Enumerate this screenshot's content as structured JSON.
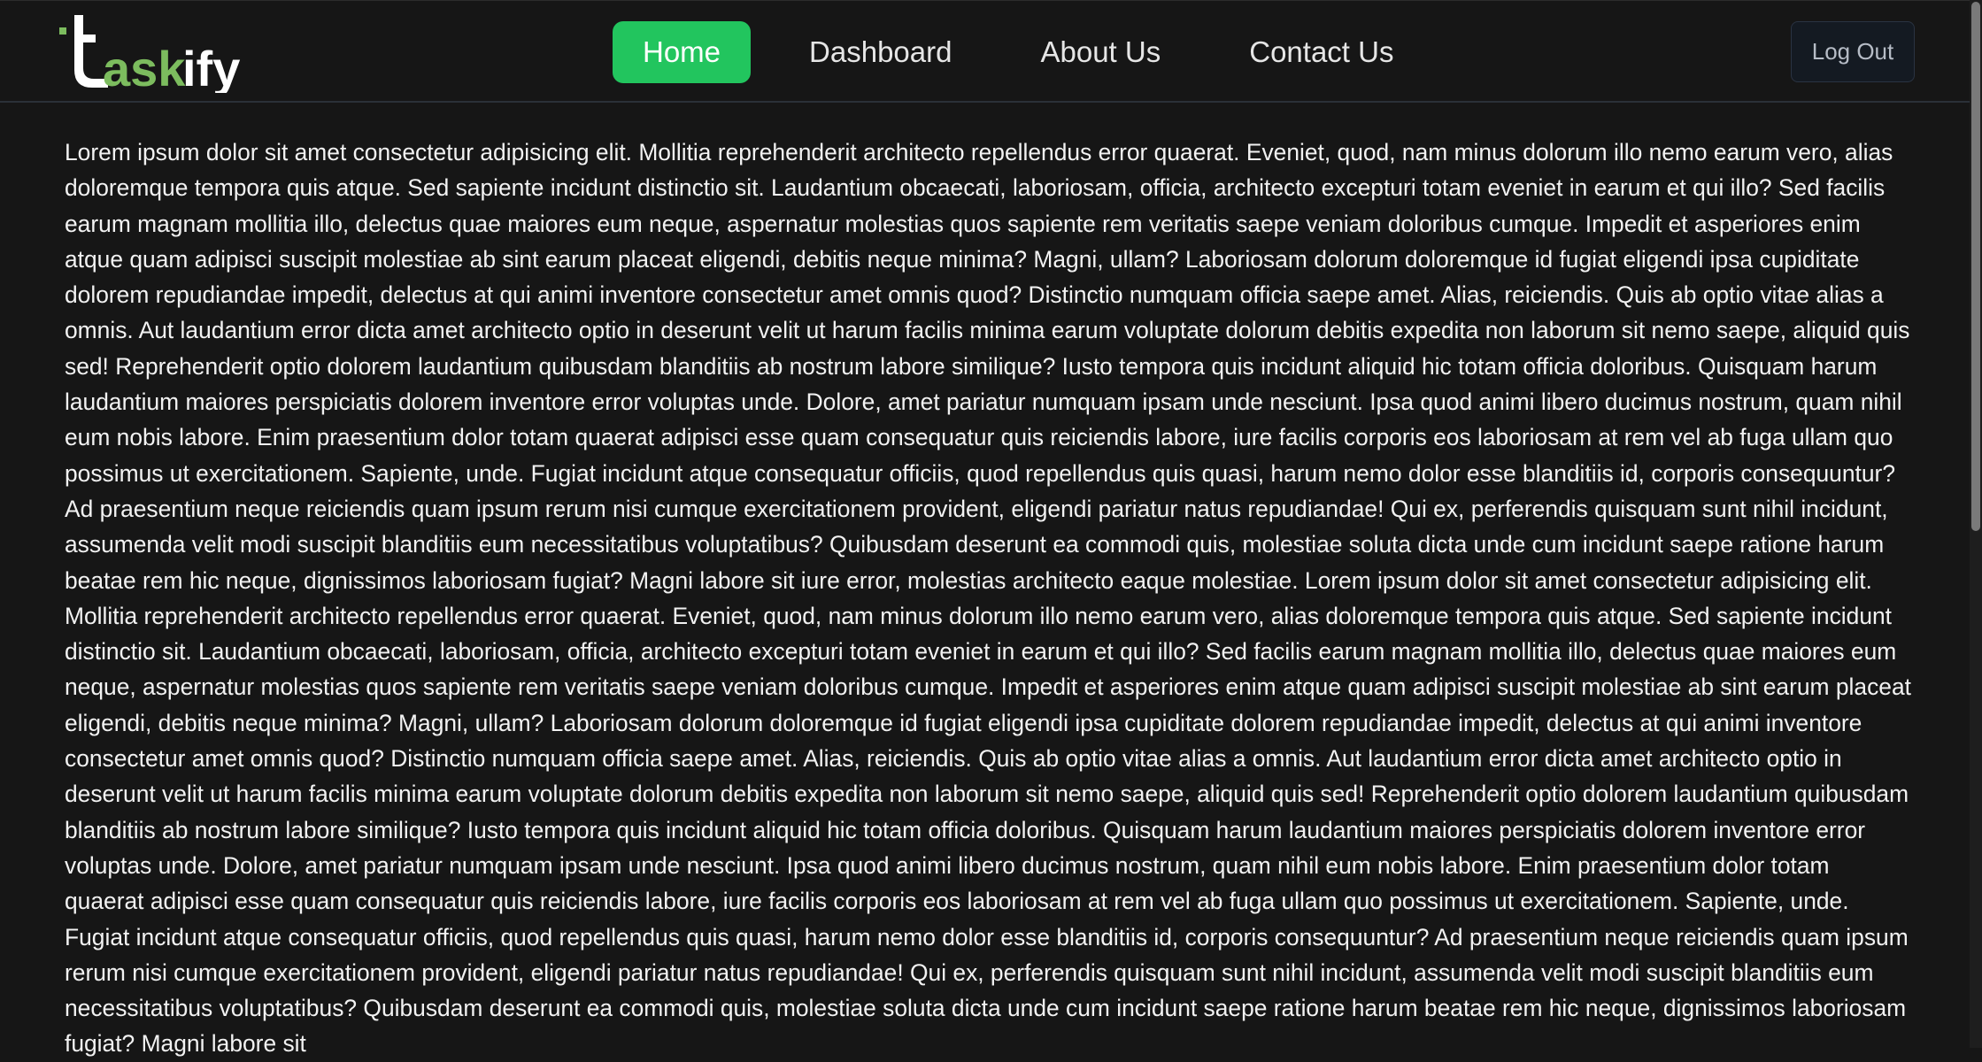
{
  "brand": {
    "name": "taskify",
    "colors": {
      "accent": "#22c55e",
      "logo_green": "#7cbc5e",
      "logo_white": "#ffffff",
      "background": "#161616"
    }
  },
  "nav": {
    "items": [
      {
        "label": "Home",
        "active": true
      },
      {
        "label": "Dashboard",
        "active": false
      },
      {
        "label": "About Us",
        "active": false
      },
      {
        "label": "Contact Us",
        "active": false
      }
    ],
    "logout_label": "Log Out"
  },
  "main": {
    "paragraph": "Lorem ipsum dolor sit amet consectetur adipisicing elit. Mollitia reprehenderit architecto repellendus error quaerat. Eveniet, quod, nam minus dolorum illo nemo earum vero, alias doloremque tempora quis atque. Sed sapiente incidunt distinctio sit. Laudantium obcaecati, laboriosam, officia, architecto excepturi totam eveniet in earum et qui illo? Sed facilis earum magnam mollitia illo, delectus quae maiores eum neque, aspernatur molestias quos sapiente rem veritatis saepe veniam doloribus cumque. Impedit et asperiores enim atque quam adipisci suscipit molestiae ab sint earum placeat eligendi, debitis neque minima? Magni, ullam? Laboriosam dolorum doloremque id fugiat eligendi ipsa cupiditate dolorem repudiandae impedit, delectus at qui animi inventore consectetur amet omnis quod? Distinctio numquam officia saepe amet. Alias, reiciendis. Quis ab optio vitae alias a omnis. Aut laudantium error dicta amet architecto optio in deserunt velit ut harum facilis minima earum voluptate dolorum debitis expedita non laborum sit nemo saepe, aliquid quis sed! Reprehenderit optio dolorem laudantium quibusdam blanditiis ab nostrum labore similique? Iusto tempora quis incidunt aliquid hic totam officia doloribus. Quisquam harum laudantium maiores perspiciatis dolorem inventore error voluptas unde. Dolore, amet pariatur numquam ipsam unde nesciunt. Ipsa quod animi libero ducimus nostrum, quam nihil eum nobis labore. Enim praesentium dolor totam quaerat adipisci esse quam consequatur quis reiciendis labore, iure facilis corporis eos laboriosam at rem vel ab fuga ullam quo possimus ut exercitationem. Sapiente, unde. Fugiat incidunt atque consequatur officiis, quod repellendus quis quasi, harum nemo dolor esse blanditiis id, corporis consequuntur? Ad praesentium neque reiciendis quam ipsum rerum nisi cumque exercitationem provident, eligendi pariatur natus repudiandae! Qui ex, perferendis quisquam sunt nihil incidunt, assumenda velit modi suscipit blanditiis eum necessitatibus voluptatibus? Quibusdam deserunt ea commodi quis, molestiae soluta dicta unde cum incidunt saepe ratione harum beatae rem hic neque, dignissimos laboriosam fugiat? Magni labore sit iure error, molestias architecto eaque molestiae. Lorem ipsum dolor sit amet consectetur adipisicing elit. Mollitia reprehenderit architecto repellendus error quaerat. Eveniet, quod, nam minus dolorum illo nemo earum vero, alias doloremque tempora quis atque. Sed sapiente incidunt distinctio sit. Laudantium obcaecati, laboriosam, officia, architecto excepturi totam eveniet in earum et qui illo? Sed facilis earum magnam mollitia illo, delectus quae maiores eum neque, aspernatur molestias quos sapiente rem veritatis saepe veniam doloribus cumque. Impedit et asperiores enim atque quam adipisci suscipit molestiae ab sint earum placeat eligendi, debitis neque minima? Magni, ullam? Laboriosam dolorum doloremque id fugiat eligendi ipsa cupiditate dolorem repudiandae impedit, delectus at qui animi inventore consectetur amet omnis quod? Distinctio numquam officia saepe amet. Alias, reiciendis. Quis ab optio vitae alias a omnis. Aut laudantium error dicta amet architecto optio in deserunt velit ut harum facilis minima earum voluptate dolorum debitis expedita non laborum sit nemo saepe, aliquid quis sed! Reprehenderit optio dolorem laudantium quibusdam blanditiis ab nostrum labore similique? Iusto tempora quis incidunt aliquid hic totam officia doloribus. Quisquam harum laudantium maiores perspiciatis dolorem inventore error voluptas unde. Dolore, amet pariatur numquam ipsam unde nesciunt. Ipsa quod animi libero ducimus nostrum, quam nihil eum nobis labore. Enim praesentium dolor totam quaerat adipisci esse quam consequatur quis reiciendis labore, iure facilis corporis eos laboriosam at rem vel ab fuga ullam quo possimus ut exercitationem. Sapiente, unde. Fugiat incidunt atque consequatur officiis, quod repellendus quis quasi, harum nemo dolor esse blanditiis id, corporis consequuntur? Ad praesentium neque reiciendis quam ipsum rerum nisi cumque exercitationem provident, eligendi pariatur natus repudiandae! Qui ex, perferendis quisquam sunt nihil incidunt, assumenda velit modi suscipit blanditiis eum necessitatibus voluptatibus? Quibusdam deserunt ea commodi quis, molestiae soluta dicta unde cum incidunt saepe ratione harum beatae rem hic neque, dignissimos laboriosam fugiat? Magni labore sit"
  }
}
